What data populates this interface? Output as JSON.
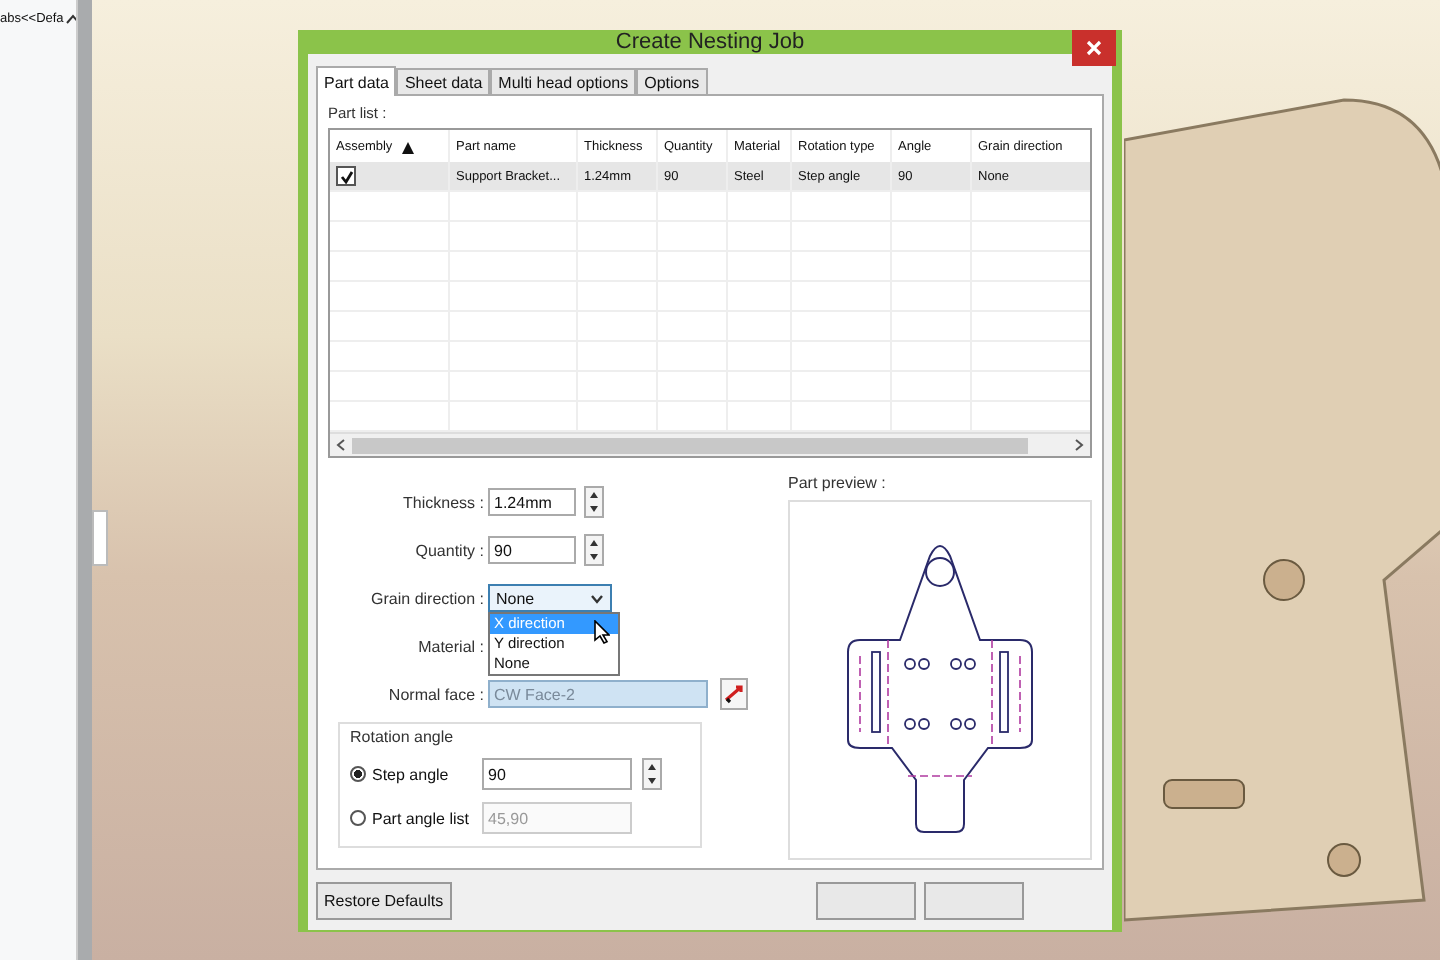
{
  "sidebar": {
    "header": "abs<<Defa"
  },
  "dialog": {
    "title": "Create Nesting Job",
    "tabs": [
      {
        "label": "Part data",
        "selected": true
      },
      {
        "label": "Sheet data",
        "selected": false
      },
      {
        "label": "Multi head options",
        "selected": false
      },
      {
        "label": "Options",
        "selected": false
      }
    ],
    "part_list": {
      "label": "Part list :",
      "columns": [
        "Assembly",
        "Part name",
        "Thickness",
        "Quantity",
        "Material",
        "Rotation type",
        "Angle",
        "Grain direction"
      ],
      "rows": [
        {
          "checked": true,
          "selected": true,
          "cells": [
            "",
            "Support Bracket...",
            "1.24mm",
            "90",
            "Steel",
            "Step angle",
            "90",
            "None"
          ]
        }
      ]
    },
    "fields": [
      {
        "kind": "spin",
        "label": "Thickness :",
        "value": "1.24mm"
      },
      {
        "kind": "spin",
        "label": "Quantity :",
        "value": "90"
      },
      {
        "kind": "dropdown",
        "label": "Grain direction :",
        "value": "None",
        "expanded": true,
        "options": [
          {
            "label": "X direction",
            "highlighted": true
          },
          {
            "label": "Y direction",
            "highlighted": false
          },
          {
            "label": "None",
            "highlighted": false
          }
        ]
      },
      {
        "kind": "hidden",
        "label": "Material :"
      },
      {
        "kind": "face",
        "label": "Normal face :",
        "value": "CW Face-2"
      }
    ],
    "rotation": {
      "title": "Rotation angle",
      "options": [
        {
          "label": "Step angle",
          "selected": true,
          "value": "90",
          "disabled": false
        },
        {
          "label": "Part angle list",
          "selected": false,
          "value": "45,90",
          "disabled": true
        }
      ]
    },
    "preview": {
      "label": "Part preview :"
    },
    "restore_button": "Restore Defaults"
  }
}
